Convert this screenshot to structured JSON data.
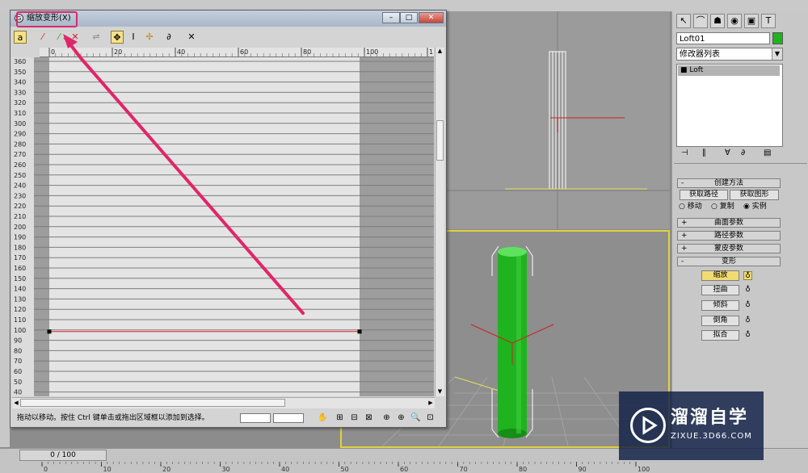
{
  "window": {
    "title": "缩放变形(X)",
    "status_text": "拖动以移动。按住 Ctrl 键单击或拖出区域框以添加到选择。",
    "ruler_x_labels": [
      "0",
      "20",
      "40",
      "60",
      "80",
      "100",
      "1:"
    ],
    "y_labels": [
      "360",
      "350",
      "340",
      "330",
      "320",
      "310",
      "300",
      "290",
      "280",
      "270",
      "260",
      "250",
      "240",
      "230",
      "220",
      "210",
      "200",
      "190",
      "180",
      "170",
      "160",
      "150",
      "140",
      "130",
      "120",
      "110",
      "100",
      "90",
      "80",
      "70",
      "60",
      "50",
      "40"
    ],
    "curve_value": 100,
    "curve_color": "#e0202a"
  },
  "command_panel": {
    "object_name": "Loft01",
    "object_color": "#1fb31f",
    "modifier_list": "修改器列表",
    "stack_item": "Loft",
    "rollouts": {
      "creation_method": "创建方法",
      "get_path": "获取路径",
      "get_shape": "获取图形",
      "move": "移动",
      "copy": "复制",
      "instance": "实例",
      "surface_params": "曲面参数",
      "path_params": "路径参数",
      "skin_params": "蒙皮参数",
      "deformations": "变形"
    },
    "deform_buttons": [
      "缩放",
      "扭曲",
      "倾斜",
      "倒角",
      "拟合"
    ]
  },
  "timeline": {
    "slider": "0 / 100",
    "ticks": [
      "0",
      "10",
      "20",
      "30",
      "40",
      "50",
      "60",
      "70",
      "80",
      "90",
      "100"
    ]
  },
  "watermark": {
    "brand": "溜溜自学",
    "url": "ZIXUE.3D66.COM"
  },
  "colors": {
    "highlight": "#d9296a",
    "arrow": "#e0256a",
    "loft_green": "#1fb31f",
    "active_viewport": "#e3d23a"
  }
}
